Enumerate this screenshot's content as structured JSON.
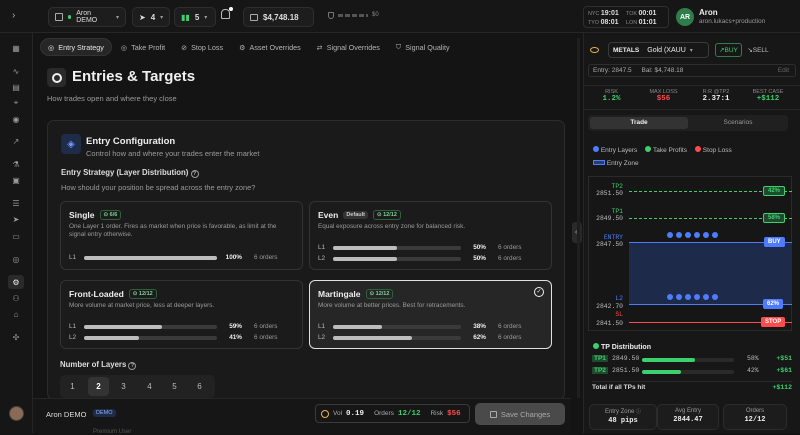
{
  "topbar": {
    "account": "Aron DEMO",
    "signals_count": "4",
    "strategies_count": "5",
    "balance": "$4,748.18",
    "pnl_small": "$0",
    "clocks": [
      {
        "city": "NYC",
        "time": "19:01",
        "date": "TOK",
        "time2": "00:01"
      },
      {
        "city": "TYO",
        "time": "08:01",
        "date": "LON",
        "time2": "01:01"
      }
    ],
    "avatar": "AR",
    "user_name": "Aron",
    "user_email": "aron.lukacs+production"
  },
  "tabs": [
    "Entry Strategy",
    "Take Profit",
    "Stop Loss",
    "Asset Overrides",
    "Signal Overrides",
    "Signal Quality"
  ],
  "page": {
    "title": "Entries & Targets",
    "subtitle": "How trades open and where they close"
  },
  "entry_config": {
    "title": "Entry Configuration",
    "subtitle": "Control how and where your trades enter the market",
    "strategy_label": "Entry Strategy (Layer Distribution)",
    "strategy_question": "How should your position be spread across the entry zone?",
    "options": [
      {
        "name": "Single",
        "score": "6/6",
        "default": "",
        "desc": "One Layer 1 order. Fires as market when price is favorable, as limit at the signal entry otherwise.",
        "layers": [
          {
            "l": "L1",
            "pct": "100%",
            "pv": 100,
            "orders": "6 orders"
          }
        ]
      },
      {
        "name": "Even",
        "score": "12/12",
        "default": "Default",
        "desc": "Equal exposure across entry zone for balanced risk.",
        "layers": [
          {
            "l": "L1",
            "pct": "50%",
            "pv": 50,
            "orders": "6 orders"
          },
          {
            "l": "L2",
            "pct": "50%",
            "pv": 50,
            "orders": "6 orders"
          }
        ]
      },
      {
        "name": "Front-Loaded",
        "score": "12/12",
        "default": "",
        "desc": "More volume at market price, less at deeper layers.",
        "layers": [
          {
            "l": "L1",
            "pct": "59%",
            "pv": 59,
            "orders": "6 orders"
          },
          {
            "l": "L2",
            "pct": "41%",
            "pv": 41,
            "orders": "6 orders"
          }
        ]
      },
      {
        "name": "Martingale",
        "score": "12/12",
        "default": "",
        "desc": "More volume at better prices. Best for retracements.",
        "layers": [
          {
            "l": "L1",
            "pct": "38%",
            "pv": 38,
            "orders": "6 orders"
          },
          {
            "l": "L2",
            "pct": "62%",
            "pv": 62,
            "orders": "6 orders"
          }
        ]
      }
    ],
    "layers_label": "Number of Layers",
    "layer_numbers": [
      "1",
      "2",
      "3",
      "4",
      "5",
      "6"
    ],
    "selected_layers": "2"
  },
  "bottom": {
    "account": "Aron DEMO",
    "demo_badge": "DEMO",
    "vol_label": "Vol",
    "vol": "0.19",
    "orders_label": "Orders",
    "orders": "12/12",
    "risk_label": "Risk",
    "risk": "$56",
    "save": "Save Changes",
    "promo": "Premium User"
  },
  "right": {
    "category": "METALS",
    "instrument": "Gold (XAUU",
    "buy": "BUY",
    "sell": "SELL",
    "entry": "Entry: 2847.5",
    "bal": "Bal: $4,748.18",
    "edit": "Edit",
    "metrics": [
      {
        "l": "RISK",
        "v": "1.2%"
      },
      {
        "l": "MAX LOSS",
        "v": "$56"
      },
      {
        "l": "R:R @TP2",
        "v": "2.37:1"
      },
      {
        "l": "BEST CASE",
        "v": "+$112"
      }
    ],
    "subtabs": [
      "Trade",
      "Scenarios"
    ],
    "legend": [
      "Entry Layers",
      "Take Profits",
      "Stop Loss",
      "Entry Zone"
    ],
    "chart": {
      "tp2_label": "TP2",
      "tp2": "2851.50",
      "tp1_label": "TP1",
      "tp1": "2849.50",
      "entry_label": "ENTRY",
      "entry": "2847.50",
      "l2_label": "L2",
      "l2": "2842.70",
      "sl_label": "SL",
      "sl": "2841.50",
      "tp2_pct": "42%",
      "tp1_pct": "58%",
      "buy_tag": "BUY",
      "l2_pct": "62%",
      "stop_tag": "STOP"
    },
    "tp_dist": {
      "title": "TP Distribution",
      "rows": [
        {
          "tp": "TP1",
          "price": "2849.50",
          "pct": "58%",
          "pv": 58,
          "pnl": "+$51"
        },
        {
          "tp": "TP2",
          "price": "2851.50",
          "pct": "42%",
          "pv": 42,
          "pnl": "+$61"
        }
      ],
      "total_label": "Total if all TPs hit",
      "total": "+$112"
    },
    "stats": [
      {
        "t": "Entry Zone",
        "v": "48 pips"
      },
      {
        "t": "Avg Entry",
        "v": "2844.47"
      },
      {
        "t": "Orders",
        "v": "12/12"
      }
    ]
  },
  "colors": {
    "accent_green": "#3ecf6e",
    "blue": "#4d7cff",
    "red": "#ff4b4b",
    "gold": "#e8b54a"
  }
}
